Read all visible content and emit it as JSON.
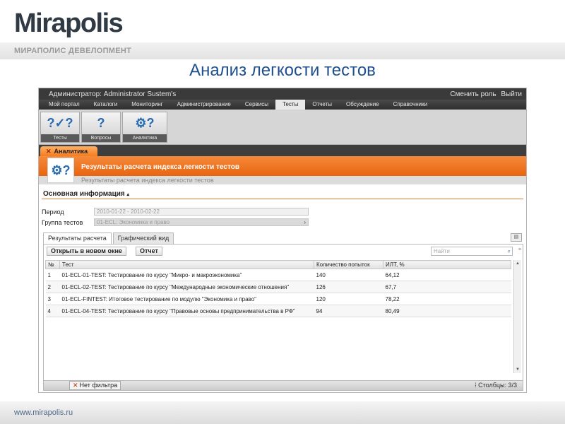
{
  "brand": {
    "logo": "Mirapolis",
    "subtitle": "МИРАПОЛИС ДЕВЕЛОПМЕНТ",
    "slide_title": "Анализ легкости тестов",
    "footer": "www.mirapolis.ru"
  },
  "app": {
    "user_label": "Администратор: Administrator Sustem's",
    "header_actions": [
      "Сменить роль",
      "Выйти"
    ],
    "menu": [
      "Мой портал",
      "Каталоги",
      "Мониторинг",
      "Администрирование",
      "Сервисы",
      "Тесты",
      "Отчеты",
      "Обсуждение",
      "Справочники"
    ],
    "active_menu": "Тесты",
    "toolbar": [
      {
        "label": "Тесты",
        "icon": "tests-icon"
      },
      {
        "label": "Вопросы",
        "icon": "questions-icon"
      },
      {
        "label": "Аналитика",
        "icon": "analytics-icon"
      }
    ],
    "tab": "Аналитика",
    "result_title": "Результаты расчета индекса легкости тестов",
    "result_subtitle": "Результаты расчета индекса легкости тестов",
    "section_title": "Основная информация",
    "fields": {
      "period_label": "Период",
      "period_value": "2010-01-22 - 2010-02-22",
      "group_label": "Группа тестов",
      "group_value": "01-ECL: Экономика и право"
    },
    "subtabs": [
      "Результаты расчета",
      "Графический вид"
    ],
    "buttons": {
      "open_new": "Открыть в новом окне",
      "report": "Отчет"
    },
    "search_placeholder": "Найти",
    "table": {
      "headers": [
        "№",
        "Тест",
        "Количество попыток",
        "ИЛТ, %"
      ],
      "rows": [
        {
          "n": "1",
          "test": "01-ECL-01-TEST: Тестирование по курсу \"Микро- и макроэкономика\"",
          "attempts": "140",
          "ilt": "64,12"
        },
        {
          "n": "2",
          "test": "01-ECL-02-TEST: Тестирование по курсу \"Международные экономические отношения\"",
          "attempts": "126",
          "ilt": "67,7"
        },
        {
          "n": "3",
          "test": "01-ECL-FINTEST: Итоговое тестирование по модулю \"Экономика и право\"",
          "attempts": "120",
          "ilt": "78,22"
        },
        {
          "n": "4",
          "test": "01-ECL-04-TEST: Тестирование по курсу \"Правовые основы предпринимательства в РФ\"",
          "attempts": "94",
          "ilt": "80,49"
        }
      ]
    },
    "status": {
      "filter": "Нет фильтра",
      "columns": "Столбцы: 3/3"
    }
  }
}
